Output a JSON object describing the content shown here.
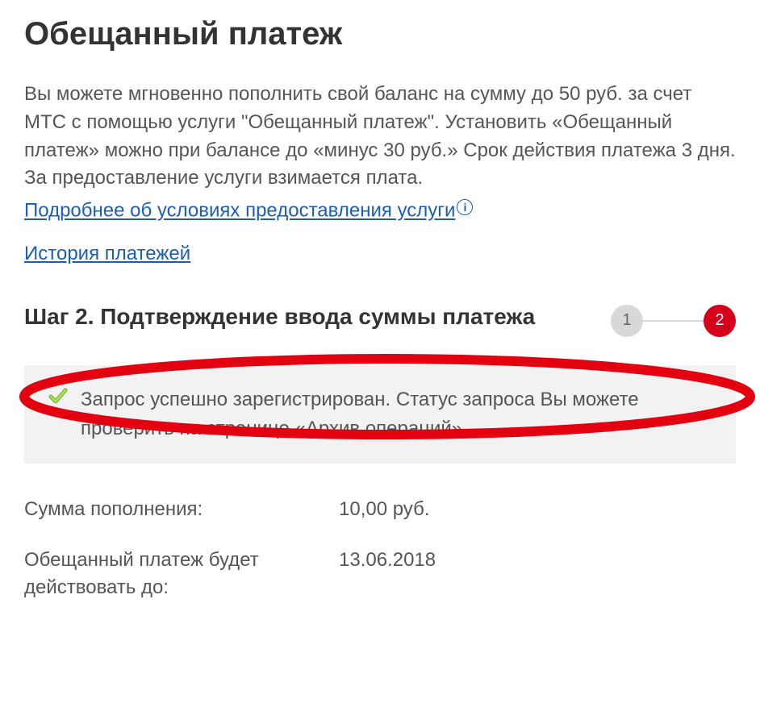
{
  "page": {
    "title": "Обещанный платеж",
    "intro": "Вы можете мгновенно пополнить свой баланс на сумму до 50 руб. за счет МТС с помощью услуги \"Обещанный платеж\". Установить «Обещанный платеж» можно при балансе до «минус 30 руб.» Срок действия платежа 3 дня. За предоставление услуги взимается плата.",
    "more_link": "Подробнее об условиях предоставления услуги",
    "info_icon_text": "i",
    "history_link": "История платежей"
  },
  "step": {
    "title": "Шаг 2. Подтверждение ввода суммы платежа",
    "steps": [
      "1",
      "2"
    ],
    "active_index": 1
  },
  "success": {
    "message_part1": "Запрос успешно зарегистрирован. Статус запроса Вы можете проверить на странице «",
    "archive_link": "Архив операций",
    "message_part2": "»."
  },
  "details": {
    "amount_label": "Сумма пополнения:",
    "amount_value": "10,00 руб.",
    "expires_label": "Обещанный платеж будет действовать до:",
    "expires_value": "13.06.2018"
  }
}
